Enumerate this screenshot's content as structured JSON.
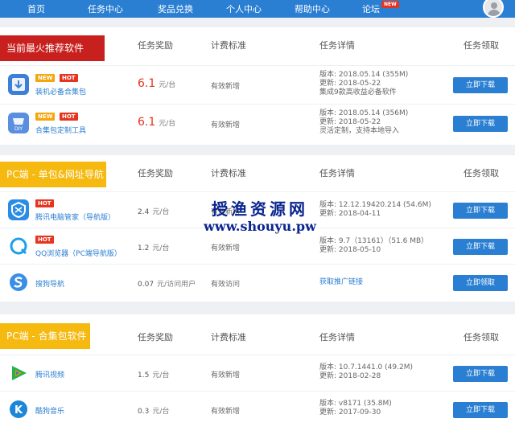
{
  "nav": {
    "items": [
      "首页",
      "任务中心",
      "奖品兑换",
      "个人中心",
      "帮助中心",
      "论坛"
    ],
    "new_badge": "NEW"
  },
  "headers": {
    "reward": "任务奖励",
    "standard": "计费标准",
    "details": "任务详情",
    "claim": "任务领取"
  },
  "sections": [
    {
      "title": "当前最火推荐软件",
      "rows": [
        {
          "name": "装机必备合集包",
          "badges": [
            "NEW",
            "HOT"
          ],
          "reward": "6.1",
          "unit": "元/台",
          "standard": "有效新增",
          "details": [
            "版本: 2018.05.14 (355M)",
            "更新: 2018-05-22",
            "集成9款高收益必备软件"
          ],
          "button": "立即下载"
        },
        {
          "name": "合集包定制工具",
          "badges": [
            "NEW",
            "HOT"
          ],
          "reward": "6.1",
          "unit": "元/台",
          "standard": "有效新增",
          "details": [
            "版本: 2018.05.14 (356M)",
            "更新: 2018-05-22",
            "灵活定制，支持本地导入"
          ],
          "button": "立即下载"
        }
      ]
    },
    {
      "title": "PC端 - 单包&网址导航",
      "rows": [
        {
          "name": "腾讯电脑管家（导航版）",
          "badges": [
            "HOT"
          ],
          "reward": "2.4",
          "unit": "元/台",
          "standard": "有效新增",
          "details": [
            "版本: 12.12.19420.214 (54.6M)",
            "更新: 2018-04-11"
          ],
          "button": "立即下载"
        },
        {
          "name": "QQ浏览器（PC端导航版）",
          "badges": [
            "HOT"
          ],
          "reward": "1.2",
          "unit": "元/台",
          "standard": "有效新增",
          "details": [
            "版本: 9.7（13161）（51.6 MB）",
            "更新: 2018-05-10"
          ],
          "button": "立即下载"
        },
        {
          "name": "搜狗导航",
          "badges": [],
          "reward": "0.07",
          "unit": "元/访问用户",
          "standard": "有效访问",
          "details": [
            "获取推广链接"
          ],
          "button": "立即领取"
        }
      ]
    },
    {
      "title": "PC端 - 合集包软件",
      "rows": [
        {
          "name": "腾讯视频",
          "badges": [],
          "reward": "1.5",
          "unit": "元/台",
          "standard": "有效新增",
          "details": [
            "版本: 10.7.1441.0 (49.2M)",
            "更新: 2018-02-28"
          ],
          "button": "立即下载"
        },
        {
          "name": "酷狗音乐",
          "badges": [],
          "reward": "0.3",
          "unit": "元/台",
          "standard": "有效新增",
          "details": [
            "版本: v8171 (35.8M)",
            "更新: 2017-09-30"
          ],
          "button": "立即下载"
        }
      ]
    }
  ],
  "watermark": {
    "line1": "授渔资源网",
    "line2": "www.shouyu.pw"
  },
  "colors": {
    "nav": "#2a7fd2",
    "button": "#2a7fd2",
    "hot": "#e5341f",
    "new": "#f5a60f",
    "title_red": "#c8201e",
    "title_yellow": "#f5b90f"
  },
  "icons": [
    "install-pack-icon",
    "diy-tool-icon",
    "tencent-manager-icon",
    "qq-browser-icon",
    "sogou-icon",
    "tencent-video-icon",
    "kugou-icon"
  ]
}
